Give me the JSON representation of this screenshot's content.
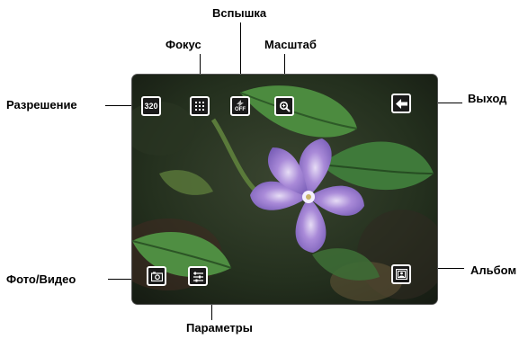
{
  "callouts": {
    "flash": "Вспышка",
    "focus": "Фокус",
    "zoom": "Масштаб",
    "resolution": "Разрешение",
    "exit": "Выход",
    "photo_video": "Фото/Видео",
    "album": "Альбом",
    "settings": "Параметры"
  },
  "buttons": {
    "resolution_value": "320",
    "flash_state": "OFF"
  },
  "icons": {
    "resolution": "resolution-icon",
    "focus": "focus-grid-icon",
    "flash": "flash-off-icon",
    "zoom": "zoom-icon",
    "exit": "arrow-left-icon",
    "photo_video": "camera-icon",
    "settings": "settings-sliders-icon",
    "album": "album-icon"
  },
  "colors": {
    "button_border": "#ffffff",
    "button_fill": "#1a1a1a",
    "flower": "#9a7fd0",
    "leaf": "#3f7a3a"
  }
}
